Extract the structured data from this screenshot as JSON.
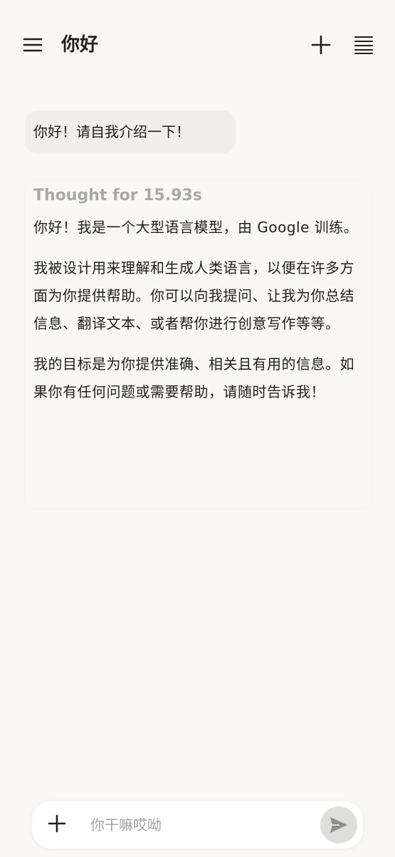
{
  "header": {
    "title": "你好",
    "menu_icon": "hamburger-menu-icon",
    "new_chat_icon": "plus-icon",
    "history_icon": "list-icon"
  },
  "conversation": {
    "user_message": "你好！请自我介绍一下！",
    "assistant": {
      "thought_label": "Thought for 15.93s",
      "paragraphs": [
        "你好！我是一个大型语言模型，由 Google 训练。",
        "我被设计用来理解和生成人类语言，以便在许多方面为你提供帮助。你可以向我提问、让我为你总结信息、翻译文本、或者帮你进行创意写作等等。",
        "我的目标是为你提供准确、相关且有用的信息。如果你有任何问题或需要帮助，请随时告诉我！"
      ]
    }
  },
  "composer": {
    "placeholder": "你干嘛哎呦",
    "value": "",
    "attach_icon": "plus-icon",
    "send_icon": "send-icon"
  },
  "colors": {
    "background": "#f9f8f5",
    "user_bubble": "#f0efeb",
    "thought_text": "#a9a9a7",
    "text": "#1f1f1f",
    "send_button": "#dededa"
  }
}
